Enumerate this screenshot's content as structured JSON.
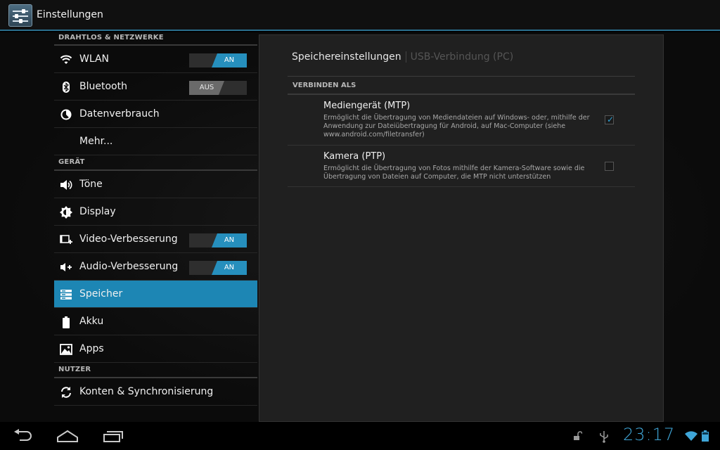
{
  "app": {
    "title": "Einstellungen",
    "icon": "settings-sliders-icon"
  },
  "sections": {
    "wireless": "DRAHTLOS & NETZWERKE",
    "device": "GERÄT",
    "user": "NUTZER"
  },
  "items": {
    "wlan": {
      "label": "WLAN",
      "icon": "wifi-icon",
      "toggle": "AN"
    },
    "bluetooth": {
      "label": "Bluetooth",
      "icon": "bluetooth-icon",
      "toggle": "AUS"
    },
    "data": {
      "label": "Datenverbrauch",
      "icon": "data-usage-icon"
    },
    "more": {
      "label": "Mehr..."
    },
    "sound": {
      "label": "Töne",
      "icon": "speaker-icon"
    },
    "display": {
      "label": "Display",
      "icon": "brightness-icon"
    },
    "video": {
      "label": "Video-Verbesserung",
      "icon": "video-enhance-icon",
      "toggle": "AN"
    },
    "audio": {
      "label": "Audio-Verbesserung",
      "icon": "audio-enhance-icon",
      "toggle": "AN"
    },
    "storage": {
      "label": "Speicher",
      "icon": "storage-icon",
      "active": true
    },
    "battery": {
      "label": "Akku",
      "icon": "battery-icon"
    },
    "apps": {
      "label": "Apps",
      "icon": "apps-icon"
    },
    "accounts": {
      "label": "Konten & Synchronisierung",
      "icon": "sync-icon"
    }
  },
  "panel": {
    "tab_active": "Speichereinstellungen",
    "tab_inactive": "USB-Verbindung (PC)",
    "connect_header": "VERBINDEN ALS",
    "options": [
      {
        "title": "Mediengerät (MTP)",
        "description": "Ermöglicht die Übertragung von Mediendateien auf Windows- oder, mithilfe der Anwendung zur Dateiübertragung für Android, auf Mac-Computer (siehe www.android.com/filetransfer)",
        "checked": true
      },
      {
        "title": "Kamera (PTP)",
        "description": "Ermöglicht die Übertragung von Fotos mithilfe der Kamera-Software sowie die Übertragung von Dateien auf Computer, die MTP nicht unterstützen",
        "checked": false
      }
    ]
  },
  "statusbar": {
    "clock": "23:17"
  },
  "colors": {
    "accent": "#1d86b4",
    "toggle_on": "#268fbd",
    "clock": "#3fa6d8"
  }
}
